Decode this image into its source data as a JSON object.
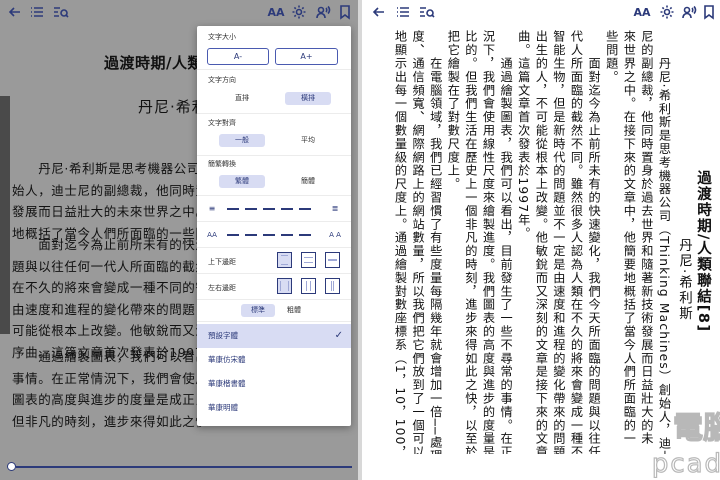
{
  "left": {
    "title": "過渡時期/人類",
    "author": "丹尼·希利",
    "paragraphs": [
      [
        "　　丹尼·希利斯是思考機器公司",
        "始人，迪士尼的副總裁，他同時置身",
        "發展而日益壯大的未來世界之中。",
        "地概括了當今人們所面臨的一些問"
      ],
      [
        "　　面對迄今為止前所未有的快速",
        "題與以往任何一代人所面臨的截然",
        "在不久的將來會變成一種不同的智",
        "由速度和進程的變化帶來的問題，",
        "可能從根本上改變。他敏銳而又深",
        "序曲。這篇文章首次發表於1997年"
      ],
      [
        "　　通過繪製圖表，我們可以看出",
        "事情。在正常情況下，我們會使用",
        "圖表的高度與進步的度量是成正比",
        "但非凡的時刻，進步來得如此之快"
      ]
    ]
  },
  "popup": {
    "font_size": {
      "title": "文字大小",
      "smaller": "A-",
      "larger": "A+"
    },
    "direction": {
      "title": "文字方向",
      "options": [
        "直排",
        "橫排"
      ],
      "selected": "橫排"
    },
    "align": {
      "title": "文字對齊",
      "options": [
        "一般",
        "平均"
      ],
      "selected": "一般"
    },
    "convert": {
      "title": "簡繁轉換",
      "options": [
        "繁體",
        "簡體"
      ],
      "selected": "繁體"
    },
    "margins_v": {
      "title": "上下邊距"
    },
    "margins_h": {
      "title": "左右邊距"
    },
    "weight": {
      "options": [
        "標準",
        "粗體"
      ],
      "selected": "標準"
    },
    "fonts": [
      "預設字體",
      "華康仿宋體",
      "華康楷書體",
      "華康明體"
    ],
    "selected_font": "預設字體"
  },
  "right": {
    "title": "過渡時期/人類聯結",
    "title_chapter": "[8]",
    "author": "丹尼·希利斯",
    "columns": [
      "　　丹尼·希利斯是思考機器公司（Thinking Machines）創始人，迪士",
      "尼的副總裁，他同時置身於過去世界和隨著新技術發展而日益壯大的未",
      "來世界之中。在接下來的文章中，他簡要地概括了當今人們所面臨的一",
      "些問題。",
      "　　面對迄今為止前所未有的快速變化，我們今天所面臨的問題與以往任何一",
      "代人所面臨的截然不同。雖然很多人認為人類在不久的將來會變成一種不同的",
      "智能生物，但是新時代的問題並不一定是由速度和進程的變化帶來的問題，作為一個巨",
      "出生的人，不可能從根本上改變。他敏銳而又深刻的文章是接下來的文章的序",
      "曲。這篇文章首次發表於1997年。",
      "　　通過繪製圖表，我們可以看出，目前發生了一些不尋常的事情。在正常情",
      "況下，我們會使用線性尺度來繪製進度。我們圖表的高度與進步的度量是成正",
      "比的。但我們生活在歷史上一個非凡的時刻，進步來得如此之快，以至於我們",
      "把它繪製在了對數尺度上。",
      "　　在電腦領域，我們已經習慣了有些度量每隔幾年就會增加一倍──處理器速",
      "度、通信頻寬、網際網路上的網站數量，所以我們把它們放到了一個可以同等",
      "地顯示出每一個數量級的尺度上。通過繪製對數座標系（1，10，100，"
    ]
  },
  "toolbar": {
    "icons": [
      "back-arrow",
      "toc-list",
      "search-list",
      "font-settings",
      "gear",
      "listen",
      "bookmark"
    ],
    "font_label": "AA"
  },
  "watermark": {
    "line1": "電腦王",
    "line2": "pcadv.tw"
  },
  "colors": {
    "accent": "#2c3a7a",
    "selected_bg": "#d8dcf3",
    "dim_page": "#9a9a9a"
  }
}
